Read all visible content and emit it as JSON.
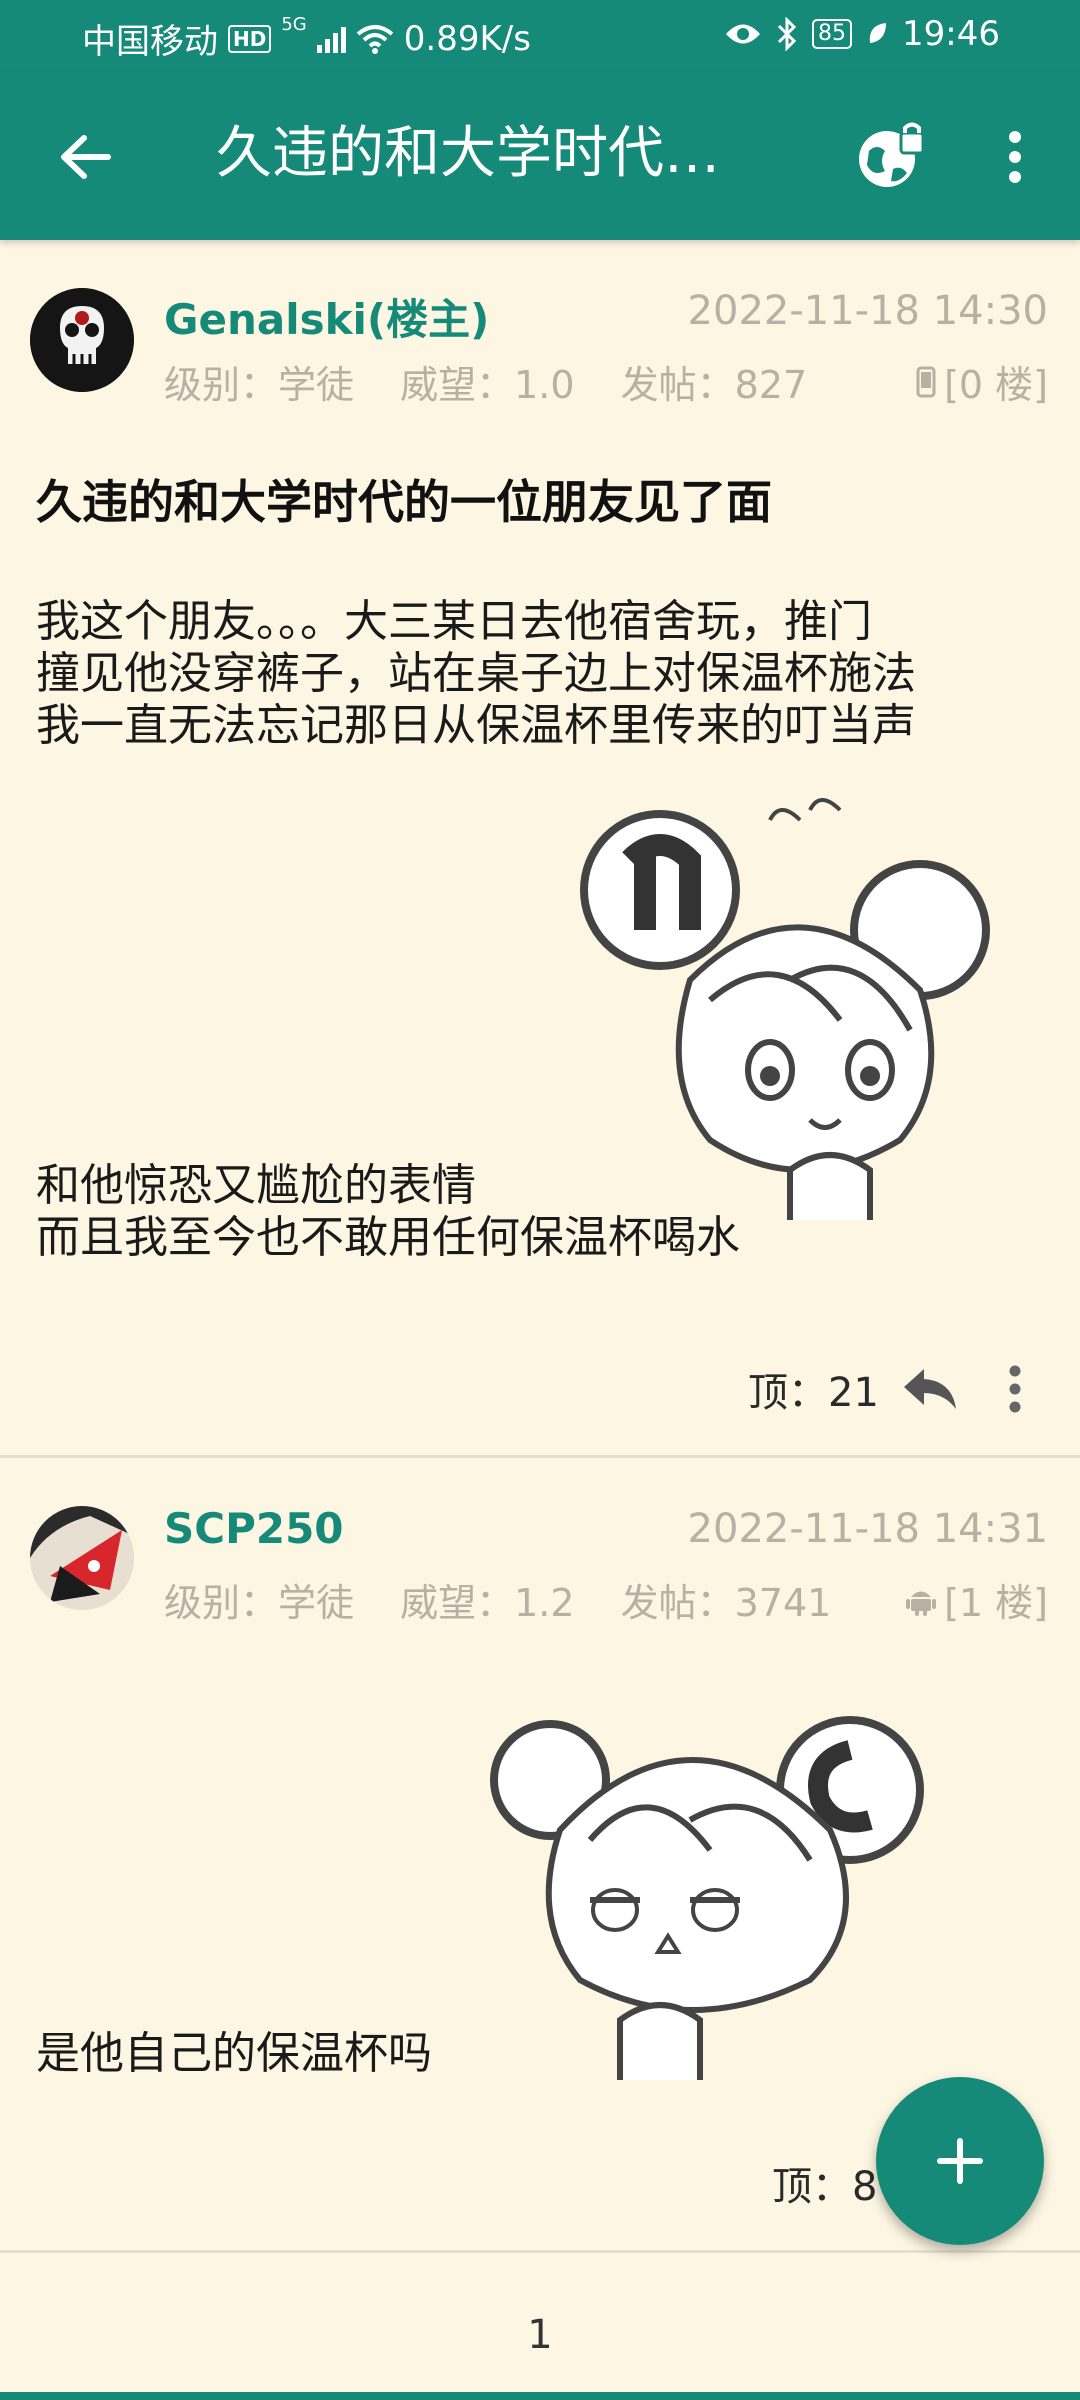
{
  "status_bar": {
    "carrier": "中国移动",
    "hd_badge": "HD",
    "network_badge": "5G",
    "speed": "0.89K/s",
    "battery": "85",
    "time": "19:46"
  },
  "app_bar": {
    "title": "久违的和大学时代…"
  },
  "posts": [
    {
      "author": "Genalski(楼主)",
      "timestamp": "2022-11-18 14:30",
      "level": "级别：学徒",
      "prestige": "威望：1.0",
      "post_count": "发帖：827",
      "floor": "[0 楼]",
      "device_icon": "phone-icon",
      "title": "久违的和大学时代的一位朋友见了面",
      "body_lines": [
        "我这个朋友。。。大三某日去他宿舍玩，推门",
        "撞见他没穿裤子，站在桌子边上对保温杯施法",
        "我一直无法忘记那日从保温杯里传来的叮当声"
      ],
      "body_lines_2": [
        "和他惊恐又尴尬的表情",
        "而且我至今也不敢用任何保温杯喝水"
      ],
      "upvotes": "顶：21"
    },
    {
      "author": "SCP250",
      "timestamp": "2022-11-18 14:31",
      "level": "级别：学徒",
      "prestige": "威望：1.2",
      "post_count": "发帖：3741",
      "floor": "[1 楼]",
      "device_icon": "android-icon",
      "body_lines": [
        "是他自己的保温杯吗"
      ],
      "upvotes": "顶：8"
    }
  ],
  "pagination": {
    "current_page": "1"
  },
  "colors": {
    "accent": "#168a78",
    "background": "#fdf6e3",
    "meta_text": "#b7b0a4"
  }
}
